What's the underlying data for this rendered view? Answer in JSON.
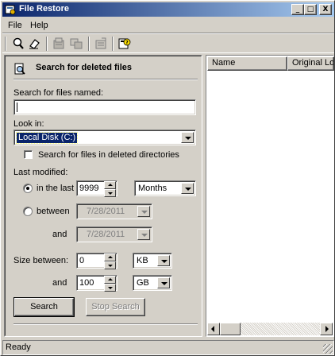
{
  "window": {
    "title": "File Restore",
    "minimize": "_",
    "maximize": "□",
    "close": "X"
  },
  "menu": [
    "File",
    "Help"
  ],
  "toolbar": {
    "icons": [
      "search-icon",
      "eraser-icon",
      "restore-icon",
      "restore-options-icon",
      "properties-icon",
      "help-icon"
    ]
  },
  "search_panel": {
    "heading": "Search for deleted files",
    "files_named_label": "Search for files named:",
    "files_named_value": "",
    "look_in_label": "Look in:",
    "look_in_value": "Local Disk (C:)",
    "deleted_dirs_label": "Search for files in deleted directories",
    "deleted_dirs_checked": false,
    "last_modified_label": "Last modified:",
    "in_the_last_label": "in the last",
    "in_the_last_value": "9999",
    "in_the_last_unit": "Months",
    "between_label": "between",
    "between_from": "7/28/2011",
    "and_label_1": "and",
    "between_to": "7/28/2011",
    "size_between_label": "Size between:",
    "size_min_value": "0",
    "size_min_unit": "KB",
    "and_label_2": "and",
    "size_max_value": "100",
    "size_max_unit": "GB",
    "search_button": "Search",
    "stop_search_button": "Stop Search"
  },
  "results": {
    "columns": [
      "Name",
      "Original Loc"
    ]
  },
  "status": "Ready",
  "colors": {
    "face": "#d4d0c8",
    "title_start": "#0a246a",
    "title_end": "#a6caf0",
    "selection": "#0a246a"
  }
}
